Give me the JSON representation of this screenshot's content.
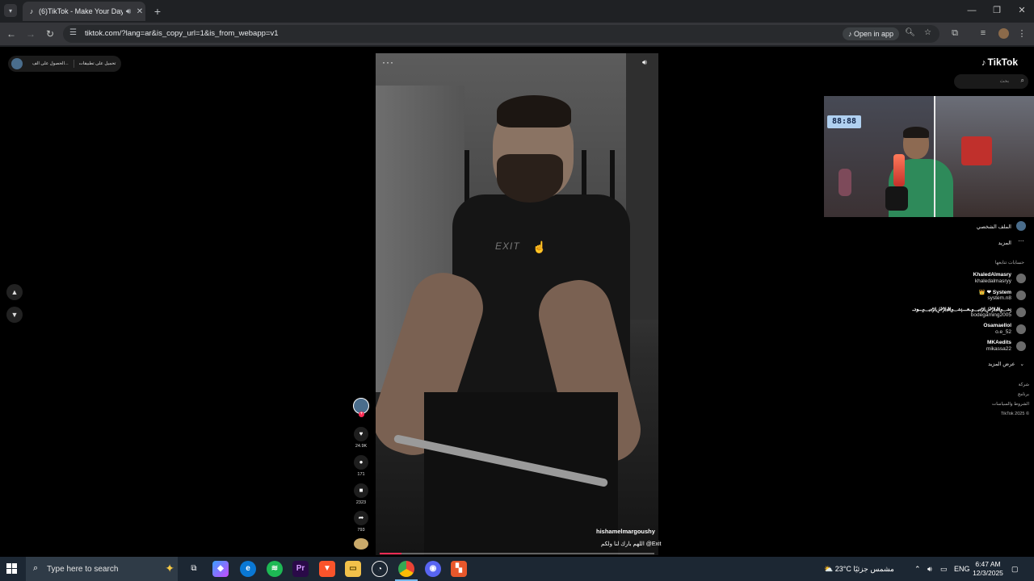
{
  "browser": {
    "tab_title": "(6)TikTok - Make Your Day",
    "url": "tiktok.com/?lang=ar&is_copy_url=1&is_from_webapp=v1",
    "open_in_app": "Open in app",
    "new_tab": "+",
    "tab_list_icon": "chevron-down-icon",
    "window_minimize": "—",
    "window_restore": "❐",
    "window_close": "✕"
  },
  "promo_pill": {
    "item1": "الحصول على الف...",
    "item2": "تحميل على تطبيقات"
  },
  "video": {
    "username": "hishamelmargoushy",
    "description": "اللهم بارك لنا ولكم @Exit",
    "shirt_text": "EXIT",
    "progress": 0.08,
    "menu": "···",
    "sound_icon": "sound-icon"
  },
  "actions": {
    "likes": "24.9K",
    "comments": "171",
    "saves": "2323",
    "shares": "793"
  },
  "sidebar": {
    "logo": "TikTok",
    "search_placeholder": "بحث",
    "profile": "الملف الشخصي",
    "more": "المزيد",
    "following_title": "حسابات تتابعها",
    "accounts": [
      {
        "name": "KhaledAlmasry",
        "handle": "khaledalmasryy"
      },
      {
        "name": "👑 ❤ System",
        "handle": "system.n8"
      },
      {
        "name": "ـعـــ﷽ــودـ﷽",
        "handle": "bodegaming2005"
      },
      {
        "name": "Osamaellol",
        "handle": "o.e_52"
      },
      {
        "name": "MKAedits",
        "handle": "mikassa22"
      }
    ],
    "see_more": "عرض المزيد",
    "footer": [
      "شركة",
      "برنامج",
      "الشروط والسياسات",
      "TikTok 2025 ©"
    ]
  },
  "webcam": {
    "clock_text": "88:88"
  },
  "taskbar": {
    "search_text": "Type here to search",
    "weather_temp": "23°C",
    "weather_text": "مشمس جزئيًا",
    "language": "ENG",
    "time": "6:47 AM",
    "date": "12/3/2025"
  }
}
